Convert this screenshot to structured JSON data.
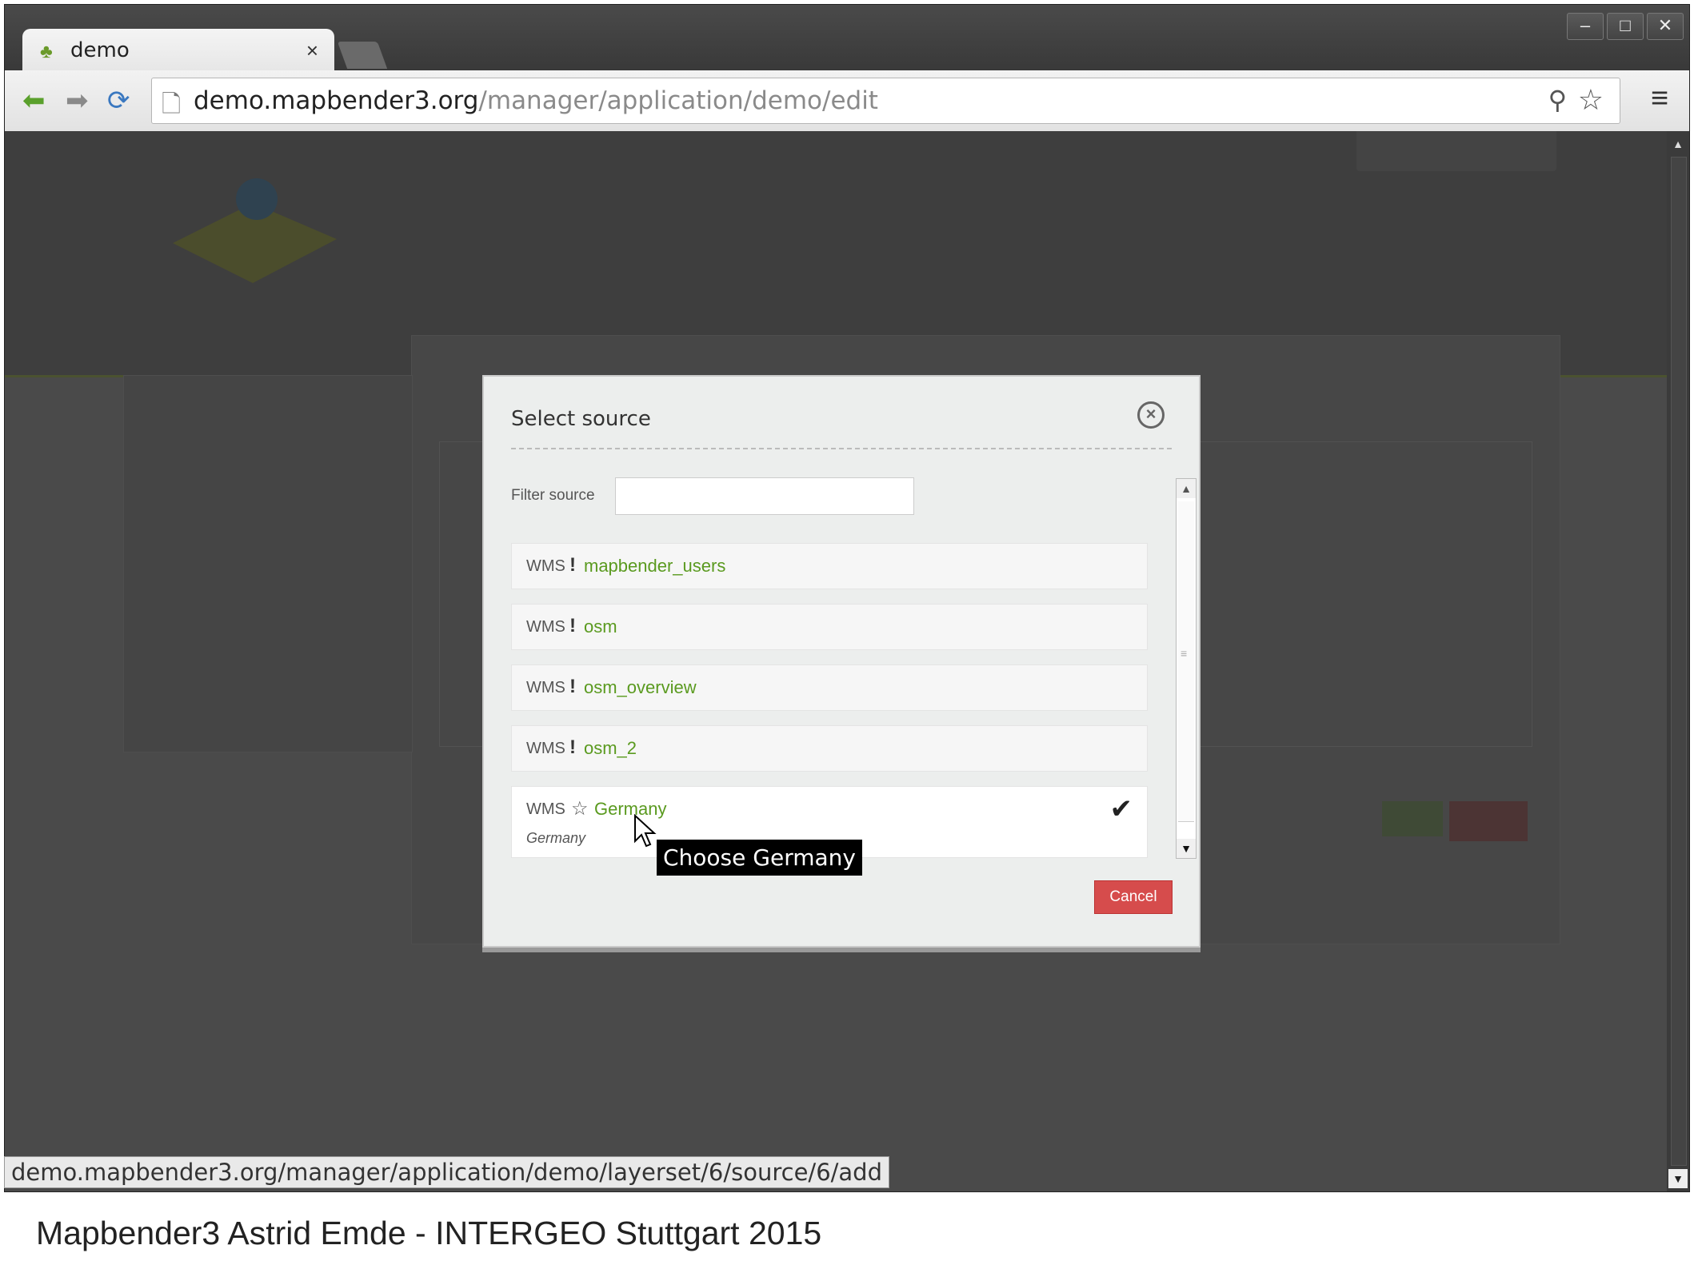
{
  "browser": {
    "tab_title": "demo",
    "tab_close": "×",
    "url_host": "demo.mapbender3.org",
    "url_path": "/manager/application/demo/edit",
    "status_url": "demo.mapbender3.org/manager/application/demo/layerset/6/source/6/add"
  },
  "modal": {
    "title": "Select source",
    "filter_label": "Filter source",
    "filter_value": "",
    "sources": [
      {
        "type": "WMS",
        "marker": "!",
        "name": "mapbender_users"
      },
      {
        "type": "WMS",
        "marker": "!",
        "name": "osm"
      },
      {
        "type": "WMS",
        "marker": "!",
        "name": "osm_overview"
      },
      {
        "type": "WMS",
        "marker": "!",
        "name": "osm_2"
      },
      {
        "type": "WMS",
        "marker": "☆",
        "name": "Germany",
        "subtitle": "Germany",
        "selected": true
      }
    ],
    "cancel_label": "Cancel",
    "tooltip": "Choose Germany"
  },
  "caption": "Mapbender3 Astrid Emde - INTERGEO Stuttgart 2015",
  "colors": {
    "source_name": "#5a9a1f",
    "cancel": "#d64c4c",
    "overlay": "#4a4a4a"
  }
}
